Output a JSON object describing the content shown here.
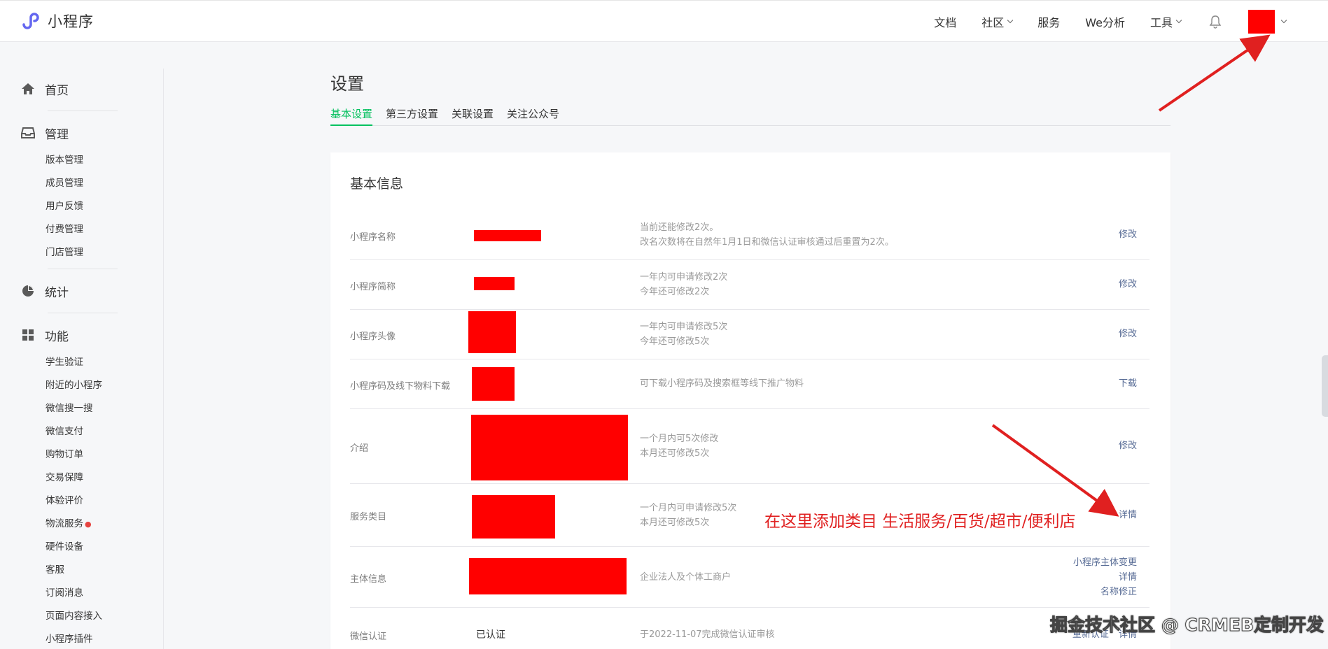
{
  "app": {
    "name": "小程序"
  },
  "topnav": {
    "items": [
      {
        "label": "文档",
        "dropdown": false
      },
      {
        "label": "社区",
        "dropdown": true
      },
      {
        "label": "服务",
        "dropdown": false
      },
      {
        "label": "We分析",
        "dropdown": false
      },
      {
        "label": "工具",
        "dropdown": true
      }
    ]
  },
  "sidebar": {
    "home": "首页",
    "manage": "管理",
    "manage_items": [
      "版本管理",
      "成员管理",
      "用户反馈",
      "付费管理",
      "门店管理"
    ],
    "stats": "统计",
    "features": "功能",
    "feature_items": [
      "学生验证",
      "附近的小程序",
      "微信搜一搜",
      "微信支付",
      "购物订单",
      "交易保障",
      "体验评价",
      "物流服务",
      "硬件设备",
      "客服",
      "订阅消息",
      "页面内容接入",
      "小程序插件"
    ]
  },
  "page": {
    "title": "设置",
    "tabs": [
      "基本设置",
      "第三方设置",
      "关联设置",
      "关注公众号"
    ],
    "active_tab": 0
  },
  "basic_info": {
    "title": "基本信息",
    "rows": [
      {
        "label": "小程序名称",
        "desc": [
          "当前还能修改2次。",
          "改名次数将在自然年1月1日和微信认证审核通过后重置为2次。"
        ],
        "actions": [
          "修改"
        ]
      },
      {
        "label": "小程序简称",
        "desc": [
          "一年内可申请修改2次",
          "今年还可修改2次"
        ],
        "actions": [
          "修改"
        ]
      },
      {
        "label": "小程序头像",
        "desc": [
          "一年内可申请修改5次",
          "今年还可修改5次"
        ],
        "actions": [
          "修改"
        ]
      },
      {
        "label": "小程序码及线下物料下载",
        "desc": [
          "可下载小程序码及搜索框等线下推广物料"
        ],
        "actions": [
          "下载"
        ]
      },
      {
        "label": "介绍",
        "desc": [
          "一个月内可5次修改",
          "本月还可修改5次"
        ],
        "actions": [
          "修改"
        ]
      },
      {
        "label": "服务类目",
        "desc": [
          "一个月内可申请修改5次",
          "本月还可修改5次"
        ],
        "actions": [
          "详情"
        ]
      },
      {
        "label": "主体信息",
        "desc": [
          "企业法人及个体工商户"
        ],
        "actions": [
          "小程序主体变更",
          "详情",
          "名称修正"
        ]
      },
      {
        "label": "微信认证",
        "value": "已认证",
        "desc": [
          "于2022-11-07完成微信认证审核"
        ],
        "actions": [
          "重新认证",
          "详情"
        ]
      }
    ]
  },
  "annotation": {
    "text": "在这里添加类目 生活服务/百货/超市/便利店",
    "color": "#e02020"
  },
  "watermark": {
    "text": "掘金技术社区 @ CRMEB定制开发"
  },
  "colors": {
    "accent": "#07c160",
    "link": "#576b95",
    "redaction": "#ff0000"
  },
  "icons": {
    "logo": "miniprogram-logo-icon",
    "bell": "bell-icon",
    "home": "home-icon",
    "manage": "inbox-icon",
    "stats": "pie-chart-icon",
    "features": "grid-icon"
  }
}
